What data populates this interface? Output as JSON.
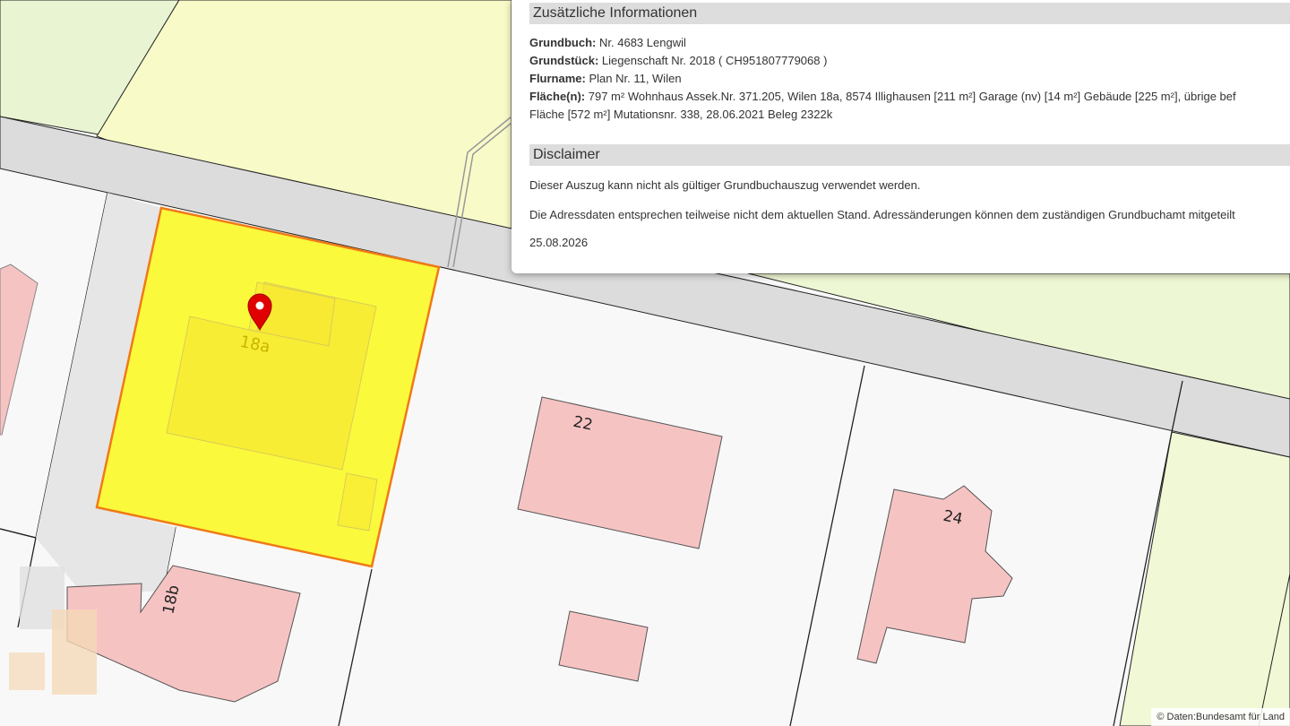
{
  "info": {
    "section_title": "Zusätzliche Informationen",
    "grundbuch": {
      "label": "Grundbuch:",
      "value": "Nr. 4683 Lengwil"
    },
    "grundstueck": {
      "label": "Grundstück:",
      "value": "Liegenschaft Nr. 2018 ( CH951807779068 )"
    },
    "flurname": {
      "label": "Flurname:",
      "value": "Plan Nr. 11, Wilen"
    },
    "flaeche": {
      "label": "Fläche(n):",
      "value": "797 m² Wohnhaus Assek.Nr. 371.205, Wilen 18a, 8574 Illighausen [211 m²] Garage (nv) [14 m²] Gebäude [225 m²], übrige bef",
      "value_line2": "Fläche [572 m²] Mutationsnr. 338, 28.06.2021 Beleg 2322k"
    }
  },
  "disclaimer": {
    "title": "Disclaimer",
    "text1": "Dieser Auszug kann nicht als gültiger Grundbuchauszug verwendet werden.",
    "text2": "Die Adressdaten entsprechen teilweise nicht dem aktuellen Stand. Adressänderungen können dem zuständigen Grundbuchamt mitgeteilt",
    "date": "25.08.2026"
  },
  "map": {
    "labels": {
      "selected_house": "18a",
      "house_18b": "18b",
      "house_22": "22",
      "house_24": "24"
    },
    "colors": {
      "background": "#f8f8f8",
      "field_green": "#f2f9d4",
      "street": "#dcdcdc",
      "building": "#f6c3c3",
      "selected_fill": "#fbf93c",
      "selected_border": "#f07a16",
      "marker": "#e00000"
    },
    "marker": "map-pin-icon"
  },
  "attribution": "© Daten:Bundesamt für Land"
}
